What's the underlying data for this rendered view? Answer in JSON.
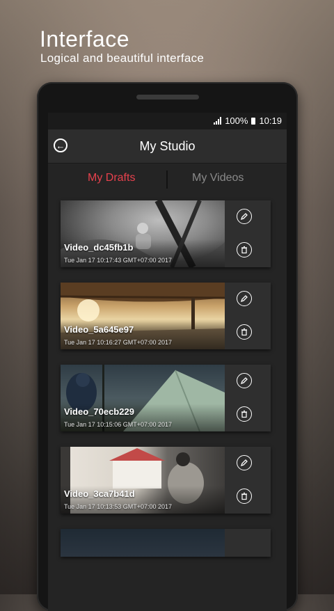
{
  "promo": {
    "title": "Interface",
    "subtitle": "Logical and beautiful interface"
  },
  "status_bar": {
    "battery": "100%",
    "time": "10:19"
  },
  "app_bar": {
    "title": "My Studio",
    "back_icon": "back-arrow-icon"
  },
  "tabs": [
    {
      "label": "My Drafts",
      "active": true
    },
    {
      "label": "My Videos",
      "active": false
    }
  ],
  "colors": {
    "accent": "#e7414d",
    "inactive_tab": "#8a8a8a",
    "surface": "#242424"
  },
  "drafts": [
    {
      "name": "Video_dc45fb1b",
      "date": "Tue Jan 17 10:17:43 GMT+07:00 2017",
      "edit_icon": "pencil-icon",
      "delete_icon": "trash-icon"
    },
    {
      "name": "Video_5a645e97",
      "date": "Tue Jan 17 10:16:27 GMT+07:00 2017",
      "edit_icon": "pencil-icon",
      "delete_icon": "trash-icon"
    },
    {
      "name": "Video_70ecb229",
      "date": "Tue Jan 17 10:15:06 GMT+07:00 2017",
      "edit_icon": "pencil-icon",
      "delete_icon": "trash-icon"
    },
    {
      "name": "Video_3ca7b41d",
      "date": "Tue Jan 17 10:13:53 GMT+07:00 2017",
      "edit_icon": "pencil-icon",
      "delete_icon": "trash-icon"
    }
  ]
}
